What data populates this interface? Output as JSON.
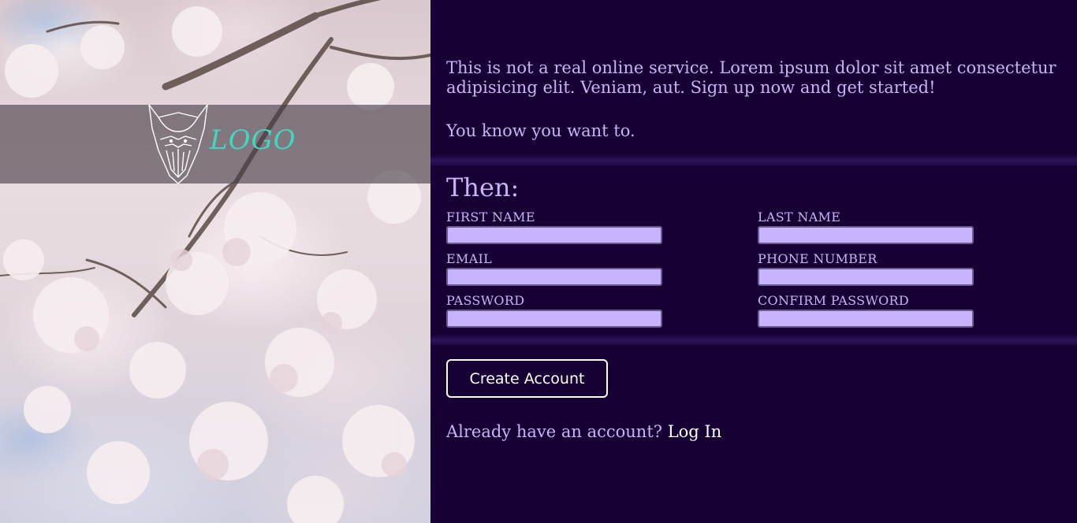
{
  "brand": {
    "logo_text": "LOGO",
    "logo_color": "#3fd9c0"
  },
  "intro": {
    "paragraph_1": "This is not a real online service. Lorem ipsum dolor sit amet consectetur adipisicing elit. Veniam, aut. Sign up now and get started!",
    "paragraph_2": "You know you want to."
  },
  "form": {
    "heading": "Then:",
    "fields": {
      "first_name": {
        "label": "FIRST NAME",
        "value": ""
      },
      "last_name": {
        "label": "LAST NAME",
        "value": ""
      },
      "email": {
        "label": "EMAIL",
        "value": ""
      },
      "phone": {
        "label": "PHONE NUMBER",
        "value": ""
      },
      "password": {
        "label": "PASSWORD",
        "value": ""
      },
      "confirm_password": {
        "label": "CONFIRM PASSWORD",
        "value": ""
      }
    },
    "submit_label": "Create Account"
  },
  "login": {
    "prompt": "Already have an account?",
    "link_label": "Log In"
  },
  "colors": {
    "panel_background": "#170033",
    "text": "#c9b3f5",
    "input_fill": "#c7b3ff",
    "button_border": "#ffffff"
  }
}
